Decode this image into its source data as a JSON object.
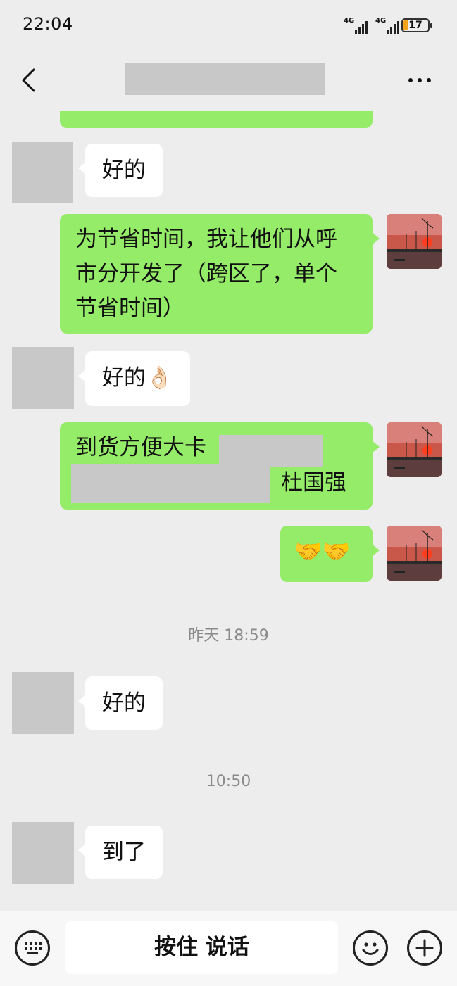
{
  "status_bar": {
    "time": "22:04",
    "network1": "4G",
    "network2": "4G",
    "battery": "17"
  },
  "nav": {
    "back_icon": "chevron-left-icon",
    "more_icon": "more-dots-icon"
  },
  "messages": {
    "m1": "好的",
    "m2": "为节省时间，我让他们从呼市分开发了（跨区了，单个节省时间）",
    "m3": "好的",
    "m3_emoji": "👌🏻",
    "m4_a": "到货方便大卡",
    "m4_b": "杜国强",
    "m5": "🤝🤝",
    "m6": "好的",
    "m7": "到了"
  },
  "timestamps": {
    "t1": "昨天 18:59",
    "t2": "10:50"
  },
  "input_bar": {
    "voice_label": "按住 说话"
  },
  "colors": {
    "sent_bubble": "#95ec69",
    "received_bubble": "#ffffff",
    "background": "#ededed"
  }
}
